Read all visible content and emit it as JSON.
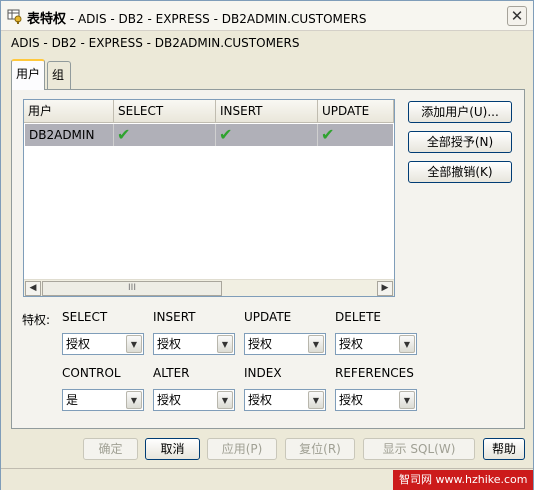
{
  "window": {
    "title_main": "表特权",
    "title_rest": " - ADIS - DB2 - EXPRESS - DB2ADMIN.CUSTOMERS",
    "close_glyph": "✕"
  },
  "subtitle": "ADIS - DB2 - EXPRESS - DB2ADMIN.CUSTOMERS",
  "tabs": [
    {
      "label": "用户",
      "active": true
    },
    {
      "label": "组",
      "active": false
    }
  ],
  "table": {
    "columns": [
      "用户",
      "SELECT",
      "INSERT",
      "UPDATE"
    ],
    "rows": [
      {
        "user": "DB2ADMIN",
        "select": "✔",
        "insert": "✔",
        "update": "✔"
      }
    ],
    "scroll_left": "◀",
    "scroll_right": "▶",
    "scroll_thumb": "III"
  },
  "side_buttons": {
    "add_user": "添加用户(U)...",
    "grant_all": "全部授予(N)",
    "revoke_all": "全部撤销(K)"
  },
  "privileges": {
    "label": "特权:",
    "row1": [
      {
        "name": "SELECT",
        "value": "授权"
      },
      {
        "name": "INSERT",
        "value": "授权"
      },
      {
        "name": "UPDATE",
        "value": "授权"
      },
      {
        "name": "DELETE",
        "value": "授权"
      }
    ],
    "row2": [
      {
        "name": "CONTROL",
        "value": "是"
      },
      {
        "name": "ALTER",
        "value": "授权"
      },
      {
        "name": "INDEX",
        "value": "授权"
      },
      {
        "name": "REFERENCES",
        "value": "授权"
      }
    ]
  },
  "footer": {
    "ok": "确定",
    "cancel": "取消",
    "apply": "应用(P)",
    "reset": "复位(R)",
    "show_sql": "显示 SQL(W)",
    "help": "帮助"
  },
  "watermark": "智司网 www.hzhike.com",
  "colors": {
    "check": "#2fa32f",
    "selected_row": "#b0b0b8",
    "watermark": "#cc1b1b"
  }
}
